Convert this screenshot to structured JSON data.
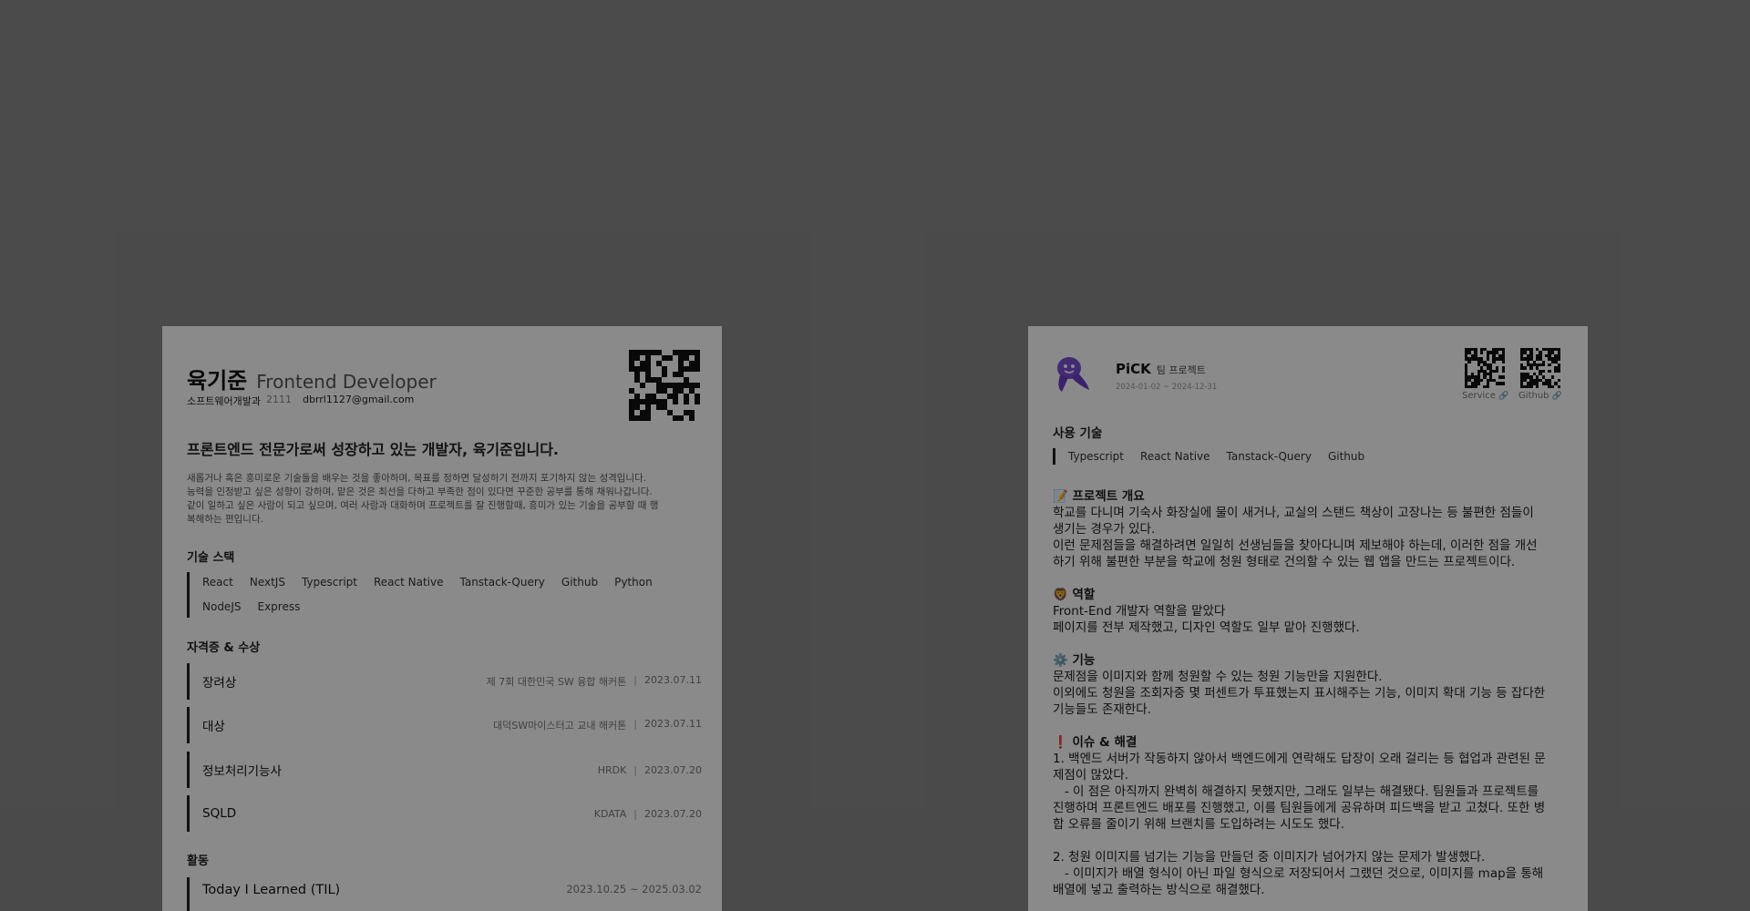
{
  "resume": {
    "name": "육기준",
    "role": "Frontend Developer",
    "dept": "소프트웨어개발과",
    "student_id": "2111",
    "email": "dbrrl1127@gmail.com",
    "headline": "프론트엔드 전문가로써 성장하고 있는 개발자, 육기준입니다.",
    "intro": [
      "새롭거나 혹은 흥미로운 기술들을 배우는 것을 좋아하며, 목표를 정하면 달성하기 전까지 포기하지 않는 성격입니다.",
      "능력을 인정받고 싶은 성향이 강하며, 맡은 것은 최선을 다하고 부족한 점이 있다면 꾸준한 공부를 통해 채워나갑니다.",
      "같이 일하고 싶은 사람이 되고 싶으며, 여러 사람과 대화하며 프로젝트를 잘 진행할때, 흥미가 있는 기술을 공부할 때 행",
      "복해하는 편입니다."
    ],
    "stack_title": "기술 스택",
    "stack": [
      "React",
      "NextJS",
      "Typescript",
      "React Native",
      "Tanstack-Query",
      "Github",
      "Python",
      "NodeJS",
      "Express"
    ],
    "certs_title": "자격증 & 수상",
    "certs": [
      {
        "name": "장려상",
        "org": "제 7회 대한민국 SW 융합 해커톤",
        "date": "2023.07.11"
      },
      {
        "name": "대상",
        "org": "대덕SW마이스터고 교내 해커톤",
        "date": "2023.07.11"
      },
      {
        "name": "정보처리기능사",
        "org": "HRDK",
        "date": "2023.07.20"
      },
      {
        "name": "SQLD",
        "org": "KDATA",
        "date": "2023.07.20"
      }
    ],
    "activity_title": "활동",
    "activity": {
      "title": "Today I Learned (TIL)",
      "period": "2023.10.25 ~ 2025.03.02"
    }
  },
  "project": {
    "name": "PiCK",
    "tag": "팀 프로젝트",
    "period": "2024-01-02 ~ 2024-12-31",
    "service_label": "Service",
    "github_label": "Github",
    "link_icon": "🔗",
    "tech_title": "사용 기술",
    "tech": [
      "Typescript",
      "React Native",
      "Tanstack-Query",
      "Github"
    ],
    "overview_head": "📝 프로젝트 개요",
    "overview": [
      "학교를 다니며 기숙사 화장실에 물이 새거나, 교실의 스탠드 책상이 고장나는 등 불편한 점들이",
      "생기는 경우가 있다.",
      "이런 문제점들을 해결하려면 일일히 선생님들을 찾아다니며 제보해야 하는데, 이러한 점을 개선",
      "하기 위해 불편한 부분을 학교에 청원 형태로 건의할 수 있는 웹 앱을 만드는 프로젝트이다."
    ],
    "role_head": "🦁 역할",
    "role": [
      "Front-End 개발자 역할을 맡았다",
      "페이지를 전부 제작했고, 디자인 역할도 일부 맡아 진행했다."
    ],
    "feature_head": "⚙️ 기능",
    "feature": [
      "문제점을 이미지와 함께 청원할 수 있는 청원 기능만을 지원한다.",
      "이외에도 청원을 조회자중 몇 퍼센트가 투표했는지 표시해주는 기능, 이미지 확대 기능 등 잡다한",
      "기능들도 존재한다."
    ],
    "issue_head": "❗ 이슈 & 해결",
    "issue1": [
      "1. 백엔드 서버가 작동하지 않아서 백엔드에게 연락해도 답장이 오래 걸리는 등 협업과 관련된 문",
      "제점이 많았다.",
      "   - 이 점은 아직까지 완벽히 해결하지 못했지만, 그래도 일부는 해결됐다. 팀원들과 프로젝트를",
      "진행하며 프론트엔드 배포를 진행했고, 이를 팀원들에게 공유하며 피드백을 받고 고쳤다. 또한 병",
      "합 오류를 줄이기 위해 브랜치를 도입하려는 시도도 했다."
    ],
    "issue2": [
      "2. 청원 이미지를 넘기는 기능을 만들던 중 이미지가 넘어가지 않는 문제가 발생했다.",
      "   - 이미지가 배열 형식이 아닌 파일 형식으로 저장되어서 그랬던 것으로, 이미지를 map을 통해",
      "배열에 넣고 출력하는 방식으로 해결했다."
    ]
  }
}
